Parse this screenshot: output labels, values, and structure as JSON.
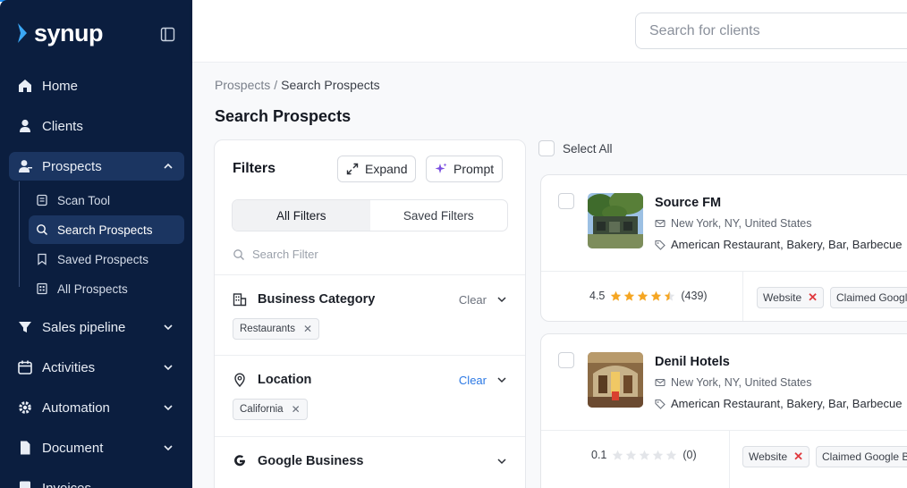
{
  "app": {
    "logo_text": "synup",
    "brand_color": "#0b1e3f",
    "accent_color": "#2b78e4"
  },
  "sidebar": {
    "items": [
      {
        "label": "Home",
        "icon": "home-icon"
      },
      {
        "label": "Clients",
        "icon": "user-icon"
      },
      {
        "label": "Prospects",
        "icon": "prospects-icon"
      },
      {
        "label": "Sales pipeline",
        "icon": "funnel-icon"
      },
      {
        "label": "Activities",
        "icon": "calendar-icon"
      },
      {
        "label": "Automation",
        "icon": "gear-icon"
      },
      {
        "label": "Document",
        "icon": "document-icon"
      },
      {
        "label": "Invoices",
        "icon": "invoice-icon"
      }
    ],
    "sub_items": [
      {
        "label": "Scan Tool",
        "icon": "scan-icon"
      },
      {
        "label": "Search Prospects",
        "icon": "search-icon"
      },
      {
        "label": "Saved Prospects",
        "icon": "bookmark-icon"
      },
      {
        "label": "All Prospects",
        "icon": "grid-icon"
      }
    ]
  },
  "topbar": {
    "search_placeholder": "Search for clients"
  },
  "breadcrumb": {
    "root": "Prospects",
    "separator": "/",
    "current": "Search Prospects"
  },
  "page": {
    "title": "Search Prospects"
  },
  "filters": {
    "title": "Filters",
    "expand_label": "Expand",
    "prompt_label": "Prompt",
    "tabs": [
      "All Filters",
      "Saved Filters"
    ],
    "search_placeholder": "Search Filter",
    "sections": [
      {
        "label": "Business Category",
        "clear": "Clear",
        "chip": "Restaurants",
        "icon": "building-icon"
      },
      {
        "label": "Location",
        "clear": "Clear",
        "chip": "California",
        "icon": "location-pin-icon"
      },
      {
        "label": "Google Business",
        "icon": "google-icon"
      }
    ]
  },
  "results": {
    "select_all_label": "Select All",
    "items": [
      {
        "name": "Source FM",
        "address": "New York, NY, United States",
        "categories": "American Restaurant, Bakery, Bar, Barbecue",
        "rating": "4.5",
        "stars": 4.5,
        "reviews": "(439)",
        "tags": [
          "Website",
          "Claimed Google"
        ]
      },
      {
        "name": "Denil Hotels",
        "address": "New York, NY, United States",
        "categories": "American Restaurant, Bakery, Bar, Barbecue",
        "rating": "0.1",
        "stars": 0,
        "reviews": "(0)",
        "tags": [
          "Website",
          "Claimed Google Business"
        ]
      }
    ]
  }
}
